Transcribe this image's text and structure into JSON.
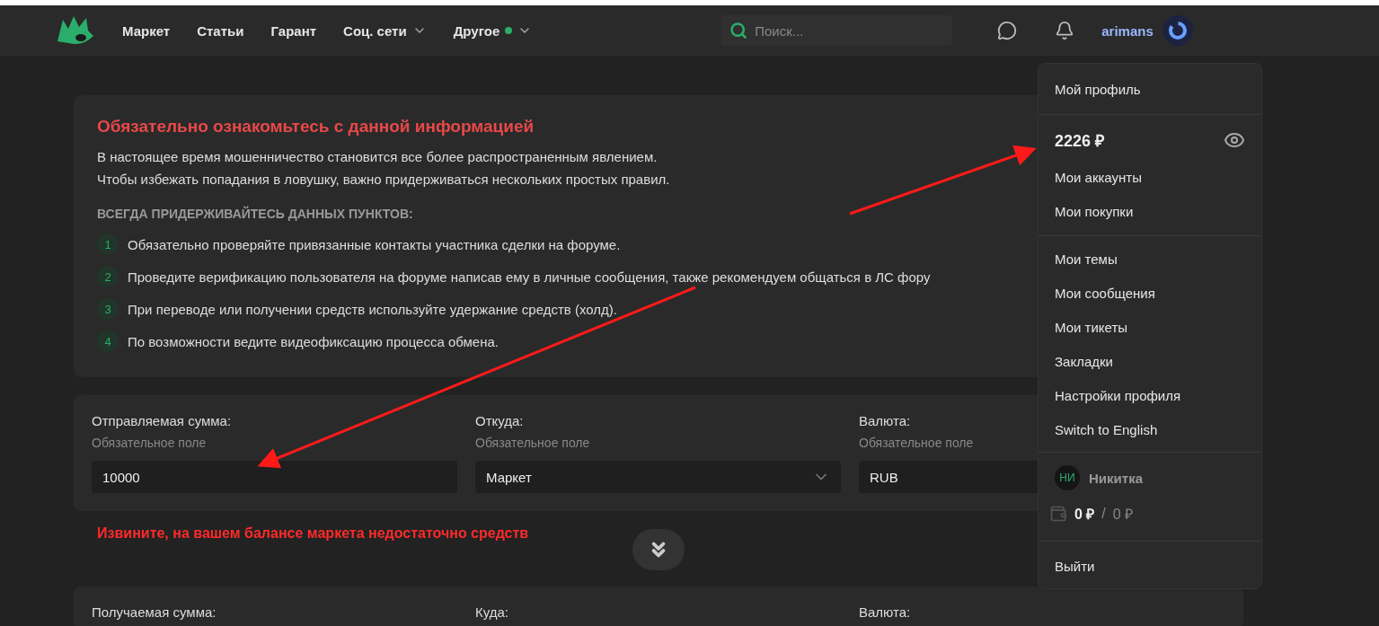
{
  "nav": {
    "items": [
      {
        "label": "Маркет",
        "dropdown": false,
        "dot": false
      },
      {
        "label": "Статьи",
        "dropdown": false,
        "dot": false
      },
      {
        "label": "Гарант",
        "dropdown": false,
        "dot": false
      },
      {
        "label": "Соц. сети",
        "dropdown": true,
        "dot": false
      },
      {
        "label": "Другое",
        "dropdown": true,
        "dot": true
      }
    ],
    "search": {
      "placeholder": "Поиск..."
    },
    "username": "arimans"
  },
  "notice": {
    "title": "Обязательно ознакомьтесь с данной информацией",
    "lines": [
      "В настоящее время мошенничество становится все более распространенным явлением.",
      "Чтобы избежать попадания в ловушку, важно придерживаться нескольких простых правил."
    ],
    "subtitle": "ВСЕГДА ПРИДЕРЖИВАЙТЕСЬ ДАННЫХ ПУНКТОВ:",
    "rules": [
      {
        "number": "1",
        "text": "Обязательно проверяйте привязанные контакты участника сделки на форуме."
      },
      {
        "number": "2",
        "text": "Проведите верификацию пользователя на форуме написав ему в личные сообщения, также рекомендуем общаться в ЛС фору"
      },
      {
        "number": "3",
        "text": "При переводе или получении средств используйте удержание средств (холд)."
      },
      {
        "number": "4",
        "text": "По возможности ведите видеофиксацию процесса обмена."
      }
    ]
  },
  "send_form": {
    "fields": [
      {
        "label": "Отправляемая сумма:",
        "hint": "Обязательное поле",
        "value": "10000",
        "kind": "input"
      },
      {
        "label": "Откуда:",
        "hint": "Обязательное поле",
        "value": "Маркет",
        "kind": "select"
      },
      {
        "label": "Валюта:",
        "hint": "Обязательное поле",
        "value": "RUB",
        "kind": "input"
      }
    ],
    "error": "Извините, на вашем балансе маркета недостаточно средств"
  },
  "receive_form": {
    "labels": [
      "Получаемая сумма:",
      "Куда:",
      "Валюта:"
    ]
  },
  "user_menu": {
    "profile": "Мой профиль",
    "balance": "2226 ₽",
    "account_items": [
      "Мои аккаунты",
      "Мои покупки"
    ],
    "items": [
      "Мои темы",
      "Мои сообщения",
      "Мои тикеты",
      "Закладки",
      "Настройки профиля",
      "Switch to English"
    ],
    "account": {
      "initials": "НИ",
      "name": "Никитка",
      "wallet_main": "0 ₽",
      "separator": "/",
      "wallet_hold": "0 ₽"
    },
    "logout": "Выйти"
  }
}
